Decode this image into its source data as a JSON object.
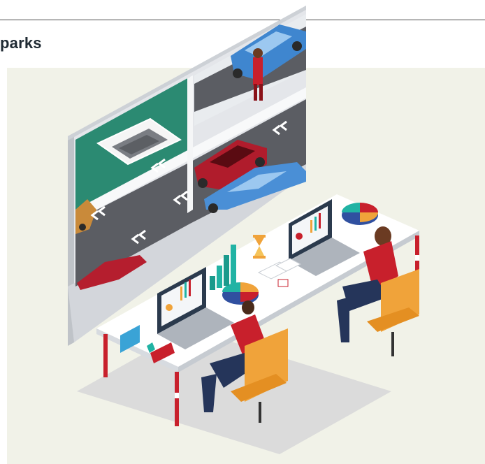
{
  "header": {
    "title": "parks"
  },
  "illustration": {
    "subject": "office-workers-monitoring-parking-garage",
    "colors": {
      "panel_bg": "#f1f2e8",
      "wall": "#e3e6ea",
      "lawn": "#2e8c74",
      "asphalt": "#5b5d63",
      "shirt_red": "#c8202c",
      "chair_orange": "#f0a33a",
      "car_blue": "#4a8fd6",
      "car_red": "#b51e2e",
      "chart_teal": "#21b3a4"
    }
  }
}
